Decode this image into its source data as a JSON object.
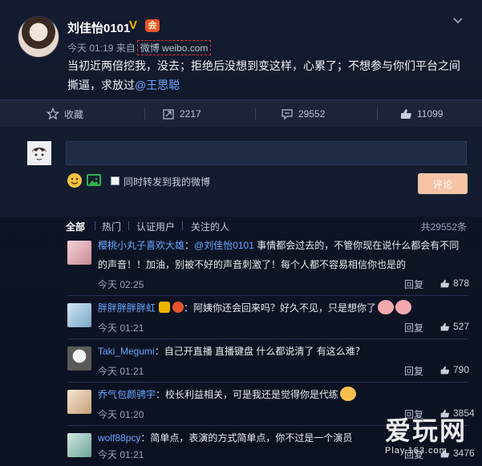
{
  "post": {
    "username": "刘佳怡0101",
    "v_badge": "V",
    "member_badge": "会",
    "time": "今天 01:19 来自",
    "source": "微博 weibo.com",
    "text_main": "当初近两倍挖我，没去；拒绝后没想到变这样，心累了；不想参与你们平台之间撕逼，求放过",
    "text_mention": "@王思聪"
  },
  "actions": {
    "favorite_label": "收藏",
    "repost_count": "2217",
    "comment_count": "29552",
    "like_count": "11099"
  },
  "composer": {
    "input_value": "",
    "also_repost_label": "同时转发到我的微博",
    "submit_label": "评论"
  },
  "tabs": {
    "all": "全部",
    "hot": "热门",
    "verified": "认证用户",
    "following": "关注的人",
    "total": "共29552条"
  },
  "comments": [
    {
      "name": "樱桃小丸子喜欢大雄",
      "text_before": "：",
      "mention": "@刘佳怡0101",
      "text": " 事情都会过去的，不管你现在说什么都会有不同的声音！！加油，别被不好的声音刺激了！每个人都不容易相信你也是的",
      "time": "今天 02:25",
      "reply": "回复",
      "likes": "878"
    },
    {
      "name": "胖胖胖胖胖虹",
      "text": "：阿姨你还会回来吗？好久不见，只是想你了",
      "time": "今天 01:21",
      "reply": "回复",
      "likes": "527"
    },
    {
      "name": "Taki_Megumi",
      "text": "：自己开直播 直播键盘 什么都说清了 有这么难？",
      "time": "今天 01:21",
      "reply": "回复",
      "likes": "790"
    },
    {
      "name": "乔气包颜骋宇",
      "text": "：校长利益相关，可是我还是觉得你是代练",
      "time": "今天 01:20",
      "reply": "回复",
      "likes": "3854"
    },
    {
      "name": "wolf88pcy",
      "text": "：简单点，表演的方式简单点，你不过是一个演员",
      "time": "今天 01:21",
      "reply": "回复",
      "likes": "3476"
    }
  ],
  "watermark": {
    "big": "爱玩网",
    "small": "Play.163.com"
  }
}
